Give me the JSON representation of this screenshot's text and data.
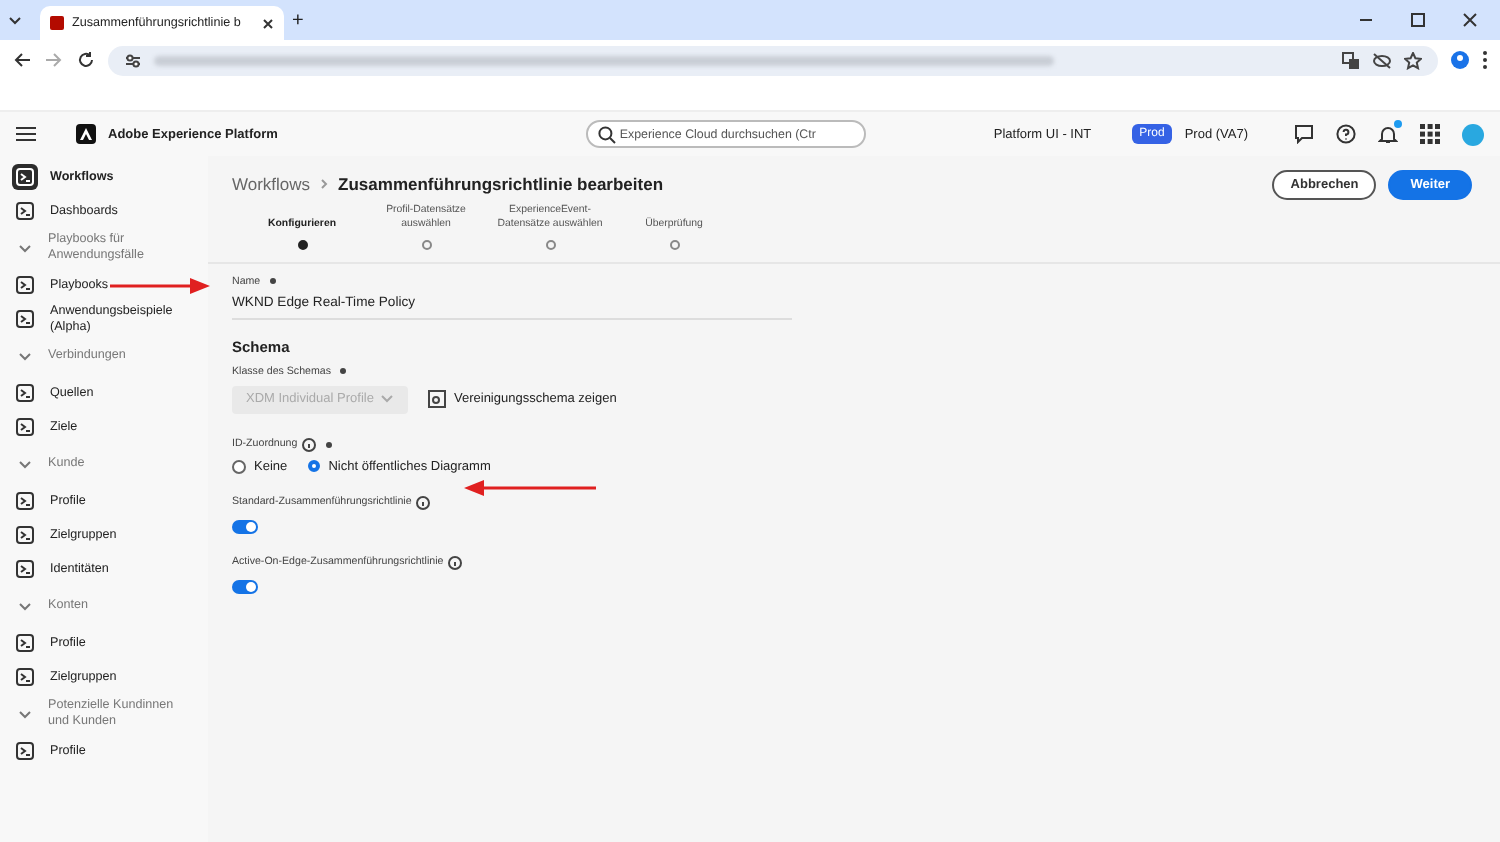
{
  "browser": {
    "tab_title": "Zusammenführungsrichtlinie b",
    "new_tab": "+"
  },
  "header": {
    "product": "Adobe Experience Platform",
    "search": {
      "placeholder": "Experience Cloud durchsuchen (Ctr"
    },
    "org": "Platform UI - INT",
    "sandbox_badge": "Prod",
    "sandbox": "Prod (VA7)",
    "notification": true
  },
  "sidebar": {
    "items": [
      {
        "kind": "item",
        "label": "Workflows",
        "selected": true
      },
      {
        "kind": "item",
        "label": "Dashboards",
        "selected": false
      },
      {
        "kind": "section",
        "label": "Playbooks für Anwendungsfälle"
      },
      {
        "kind": "item",
        "label": "Playbooks",
        "selected": false
      },
      {
        "kind": "item",
        "label": "Anwendungsbeispiele (Alpha)",
        "selected": false
      },
      {
        "kind": "section",
        "label": "Verbindungen"
      },
      {
        "kind": "item",
        "label": "Quellen",
        "selected": false
      },
      {
        "kind": "item",
        "label": "Ziele",
        "selected": false
      },
      {
        "kind": "section",
        "label": "Kunde"
      },
      {
        "kind": "item",
        "label": "Profile",
        "selected": false
      },
      {
        "kind": "item",
        "label": "Zielgruppen",
        "selected": false
      },
      {
        "kind": "item",
        "label": "Identitäten",
        "selected": false
      },
      {
        "kind": "section",
        "label": "Konten"
      },
      {
        "kind": "item",
        "label": "Profile",
        "selected": false
      },
      {
        "kind": "item",
        "label": "Zielgruppen",
        "selected": false
      },
      {
        "kind": "section",
        "label": "Potenzielle Kundinnen und Kunden"
      },
      {
        "kind": "item",
        "label": "Profile",
        "selected": false
      }
    ]
  },
  "breadcrumb": {
    "parent": "Workflows",
    "current": "Zusammenführungsrichtlinie bearbeiten"
  },
  "buttons": [
    {
      "kind": "secondary",
      "label": "Abbrechen"
    },
    {
      "kind": "primary",
      "label": "Weiter"
    }
  ],
  "steps": [
    {
      "label": "Konfigurieren",
      "selected": true
    },
    {
      "label": "Profil-Datensätze auswählen",
      "selected": false
    },
    {
      "label": "ExperienceEvent-Datensätze auswählen",
      "selected": false
    },
    {
      "label": "Überprüfung",
      "selected": false
    }
  ],
  "form": {
    "name_label": "Name",
    "name_value": "WKND Edge Real-Time Policy",
    "schema_heading": "Schema",
    "class_label": "Klasse des Schemas",
    "class_value": "XDM Individual Profile",
    "class_disabled": true,
    "view_schema": "Vereinigungsschema zeigen",
    "id_label": "ID-Zuordnung",
    "id_options": [
      {
        "label": "Keine",
        "selected": false
      },
      {
        "label": "Nicht öffentliches Diagramm",
        "selected": true
      }
    ],
    "toggles": [
      {
        "label": "Standard-Zusammenführungsrichtlinie",
        "on": true
      },
      {
        "label": "Active-On-Edge-Zusammenführungsrichtlinie",
        "on": true
      }
    ]
  },
  "annotations": [
    {
      "kind": "arrow-right"
    },
    {
      "kind": "arrow-left"
    }
  ]
}
